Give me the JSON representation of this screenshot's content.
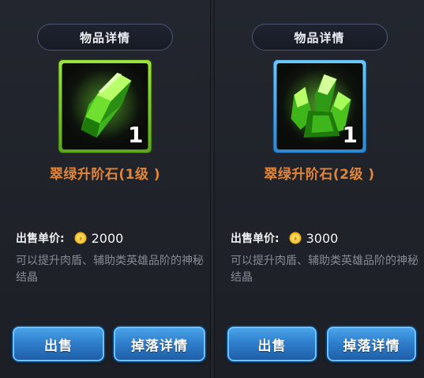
{
  "panels": [
    {
      "title": "物品详情",
      "item_name": "翠绿升阶石(1级 )",
      "quantity": "1",
      "price_label": "出售单价:",
      "price_value": "2000",
      "description": "可以提升肉盾、辅助类英雄品阶的神秘结晶",
      "sell_label": "出售",
      "drop_label": "掉落详情",
      "frame_color": "#8fd831",
      "frame_type": "green"
    },
    {
      "title": "物品详情",
      "item_name": "翠绿升阶石(2级 )",
      "quantity": "1",
      "price_label": "出售单价:",
      "price_value": "3000",
      "description": "可以提升肉盾、辅助类英雄品阶的神秘结晶",
      "sell_label": "出售",
      "drop_label": "掉落详情",
      "frame_color": "#4fb4f4",
      "frame_type": "blue"
    }
  ],
  "icons": {
    "currency": "gold-coin-icon",
    "item_1": "green-crystal-icon",
    "item_2": "green-crystal-cluster-icon"
  },
  "colors": {
    "item_name": "#e1853a",
    "button": "#2f7fce",
    "description": "#858a94"
  }
}
